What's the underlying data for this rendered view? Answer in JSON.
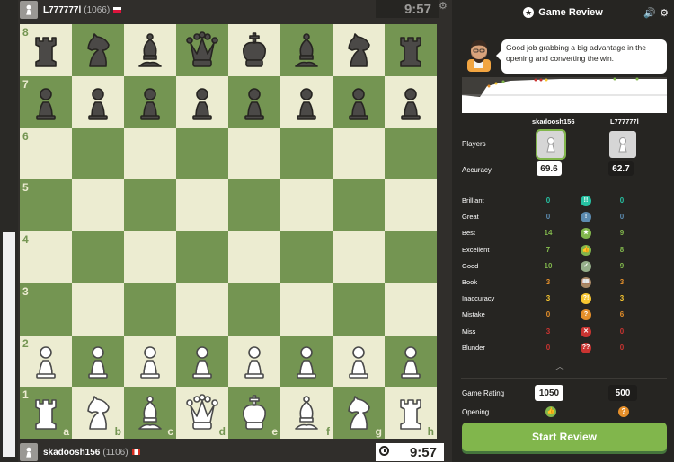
{
  "top_player": {
    "name": "L777777l",
    "rating": "(1066)",
    "clock": "9:57"
  },
  "bottom_player": {
    "name": "skadoosh156",
    "rating": "(1106)",
    "clock": "9:57"
  },
  "board": {
    "ranks": [
      "8",
      "7",
      "6",
      "5",
      "4",
      "3",
      "2",
      "1"
    ],
    "files": [
      "a",
      "b",
      "c",
      "d",
      "e",
      "f",
      "g",
      "h"
    ],
    "rows": [
      [
        "bR",
        "bN",
        "bB",
        "bQ",
        "bK",
        "bB",
        "bN",
        "bR"
      ],
      [
        "bP",
        "bP",
        "bP",
        "bP",
        "bP",
        "bP",
        "bP",
        "bP"
      ],
      [
        "",
        "",
        "",
        "",
        "",
        "",
        "",
        ""
      ],
      [
        "",
        "",
        "",
        "",
        "",
        "",
        "",
        ""
      ],
      [
        "",
        "",
        "",
        "",
        "",
        "",
        "",
        ""
      ],
      [
        "",
        "",
        "",
        "",
        "",
        "",
        "",
        ""
      ],
      [
        "wP",
        "wP",
        "wP",
        "wP",
        "wP",
        "wP",
        "wP",
        "wP"
      ],
      [
        "wR",
        "wN",
        "wB",
        "wQ",
        "wK",
        "wB",
        "wN",
        "wR"
      ]
    ],
    "light_color": "#ececd1",
    "dark_color": "#749552"
  },
  "panel": {
    "title": "Game Review",
    "coach_message": "Good job grabbing a big advantage in the opening and converting the win.",
    "players_header": [
      "skadoosh156",
      "L777777l"
    ],
    "players_label": "Players",
    "accuracy_label": "Accuracy",
    "accuracy": [
      "69.6",
      "62.7"
    ],
    "moves": [
      {
        "label": "Brilliant",
        "white": "0",
        "black": "0",
        "icon": "!!",
        "color": "#26c2a3",
        "value_color": "#26c2a3"
      },
      {
        "label": "Great",
        "white": "0",
        "black": "0",
        "icon": "!",
        "color": "#5c8bb0",
        "value_color": "#5c8bb0"
      },
      {
        "label": "Best",
        "white": "14",
        "black": "9",
        "icon": "★",
        "color": "#81b64c",
        "value_color": "#81b64c"
      },
      {
        "label": "Excellent",
        "white": "7",
        "black": "8",
        "icon": "👍",
        "color": "#81b64c",
        "value_color": "#81b64c"
      },
      {
        "label": "Good",
        "white": "10",
        "black": "9",
        "icon": "✓",
        "color": "#95af8a",
        "value_color": "#81b64c"
      },
      {
        "label": "Book",
        "white": "3",
        "black": "3",
        "icon": "📖",
        "color": "#a88865",
        "value_color": "#e6912c"
      },
      {
        "label": "Inaccuracy",
        "white": "3",
        "black": "3",
        "icon": "?!",
        "color": "#f7c631",
        "value_color": "#f7c631"
      },
      {
        "label": "Mistake",
        "white": "0",
        "black": "6",
        "icon": "?",
        "color": "#e58f2a",
        "value_color": "#e58f2a"
      },
      {
        "label": "Miss",
        "white": "3",
        "black": "0",
        "icon": "✕",
        "color": "#ca3431",
        "value_color": "#ca3431"
      },
      {
        "label": "Blunder",
        "white": "0",
        "black": "0",
        "icon": "??",
        "color": "#ca3431",
        "value_color": "#ca3431"
      }
    ],
    "game_rating_label": "Game Rating",
    "game_rating": [
      "1050",
      "500"
    ],
    "opening_label": "Opening",
    "start_button": "Start Review"
  }
}
